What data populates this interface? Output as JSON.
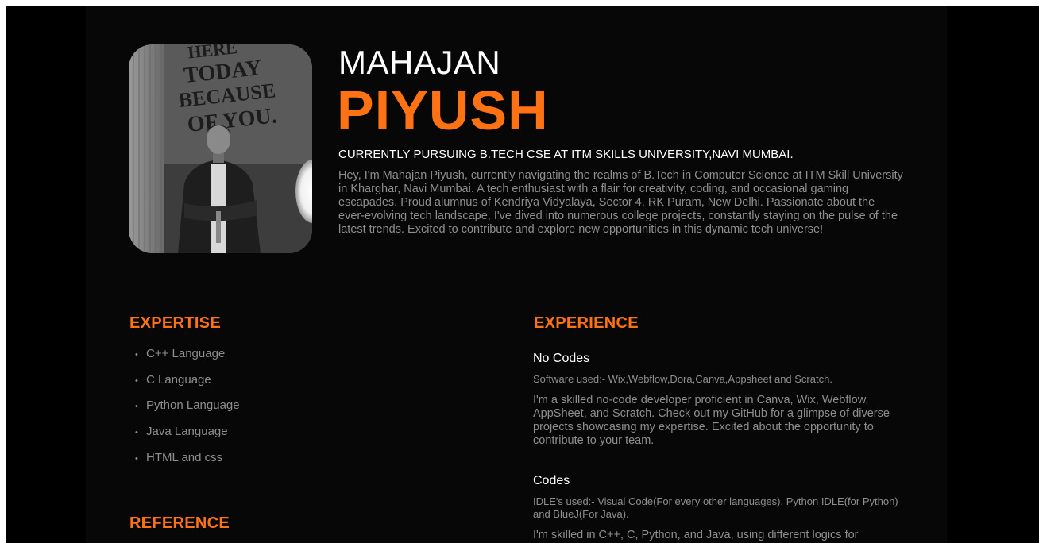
{
  "header": {
    "first_name": "MAHAJAN",
    "last_name": "PIYUSH",
    "tagline": "CURRENTLY PURSUING B.TECH CSE AT ITM SKILLS UNIVERSITY,NAVI MUMBAI.",
    "bio": "Hey, I'm Mahajan Piyush, currently navigating the realms of B.Tech in Computer Science at ITM Skill University in Kharghar, Navi Mumbai. A tech enthusiast with a flair for creativity, coding, and occasional gaming escapades. Proud alumnus of Kendriya Vidyalaya, Sector 4, RK Puram, New Delhi. Passionate about the ever-evolving tech landscape, I've dived into numerous college projects, constantly staying on the pulse of the latest trends. Excited to contribute and explore new opportunities in this dynamic tech universe!",
    "photo_sign_text": "HERE TODAY BECAUSE OF YOU."
  },
  "expertise": {
    "title": "EXPERTISE",
    "items": [
      "C++ Language",
      "C Language",
      "Python Language",
      "Java Language",
      "HTML and css"
    ]
  },
  "reference": {
    "title": "REFERENCE"
  },
  "experience": {
    "title": "EXPERIENCE",
    "jobs": [
      {
        "name": "No Codes",
        "tools": "Software used:- Wix,Webflow,Dora,Canva,Appsheet and Scratch.",
        "desc": "I'm a skilled no-code developer proficient in Canva, Wix, Webflow, AppSheet, and Scratch. Check out my GitHub for a glimpse of diverse projects showcasing my expertise. Excited about the opportunity to contribute to your team."
      },
      {
        "name": "Codes",
        "tools": "IDLE's used:- Visual Code(For every other languages), Python IDLE(for Python) and BlueJ(For Java).",
        "desc": "I'm skilled in C++, C, Python, and Java, using different logics for"
      }
    ]
  },
  "colors": {
    "accent": "#ff7214",
    "background": "#070707",
    "body_text": "#8e8e8e",
    "heading_text": "#ffffff"
  }
}
